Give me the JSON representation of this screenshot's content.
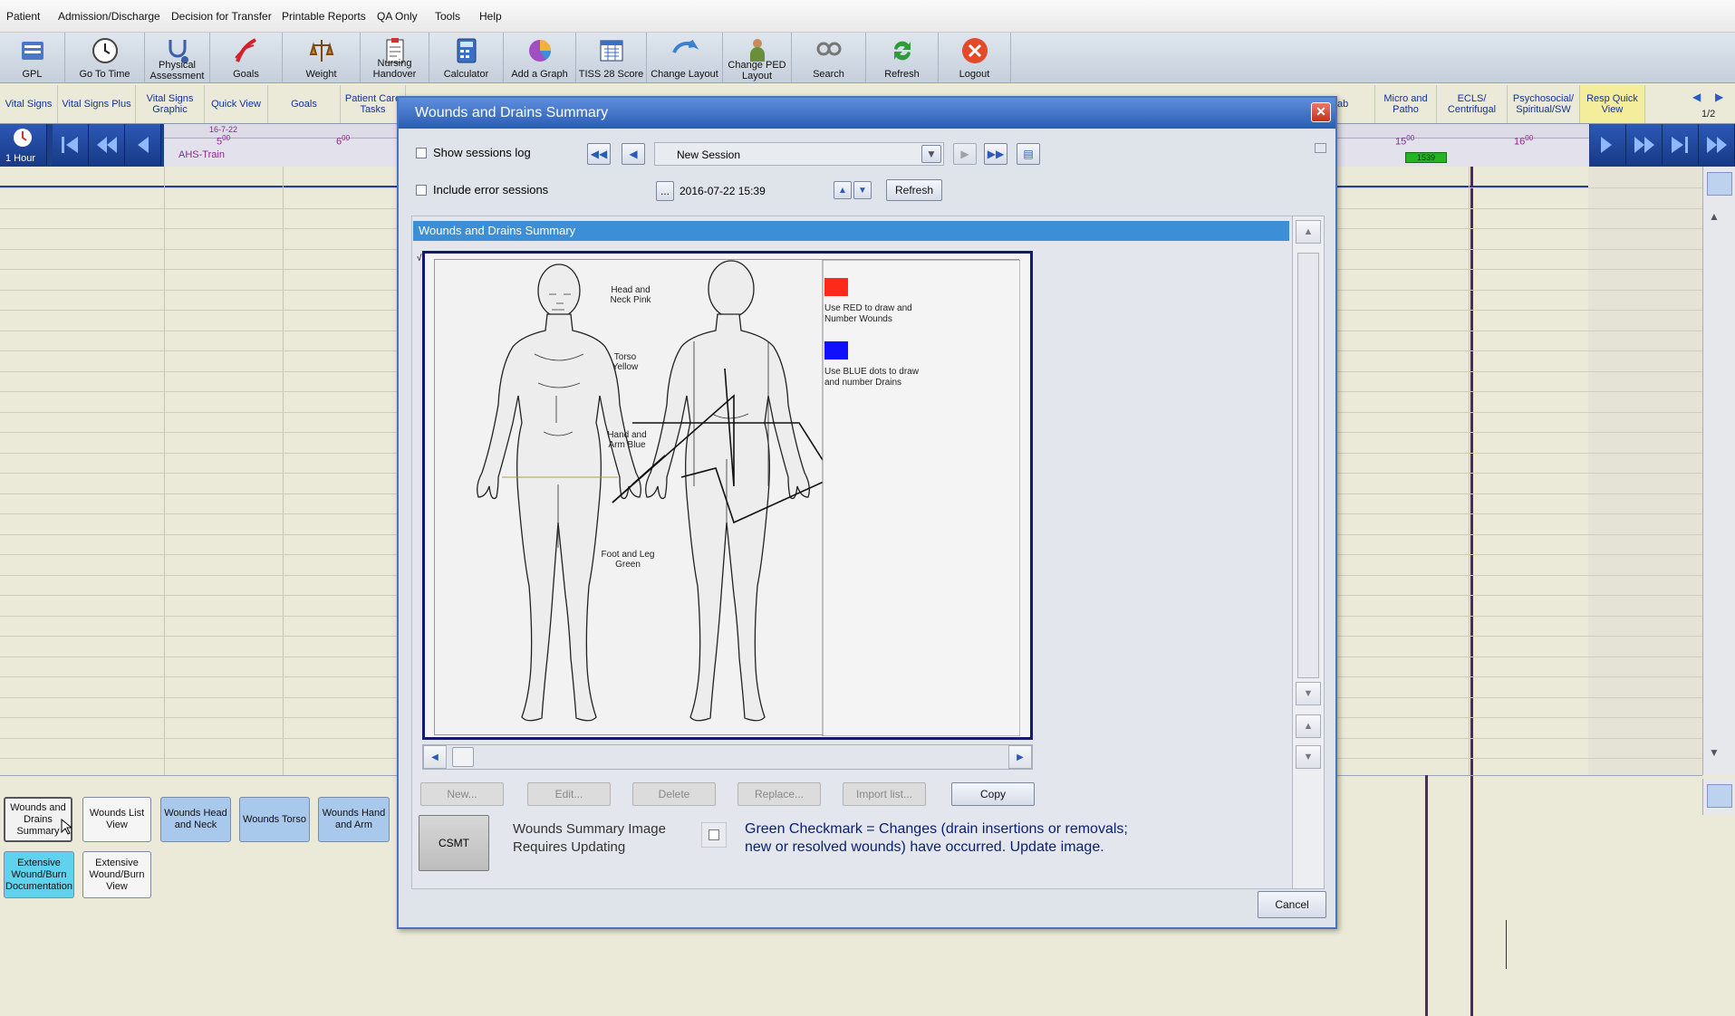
{
  "menu": [
    "Patient",
    "Admission/Discharge",
    "Decision for Transfer",
    "Printable Reports",
    "QA Only",
    "Tools",
    "Help"
  ],
  "toolbar": [
    {
      "label": "GPL",
      "icon": "gpl-icon"
    },
    {
      "label": "Go To Time",
      "icon": "clock-icon"
    },
    {
      "label": "Physical Assessment",
      "icon": "stethoscope-icon"
    },
    {
      "label": "Goals",
      "icon": "goals-icon"
    },
    {
      "label": "Weight",
      "icon": "scale-icon"
    },
    {
      "label": "Nursing Handover",
      "icon": "clipboard-icon"
    },
    {
      "label": "Calculator",
      "icon": "calculator-icon"
    },
    {
      "label": "Add a Graph",
      "icon": "graph-icon"
    },
    {
      "label": "TISS 28 Score",
      "icon": "tiss-icon"
    },
    {
      "label": "Change Layout",
      "icon": "layout-icon"
    },
    {
      "label": "Change PED Layout",
      "icon": "ped-layout-icon"
    },
    {
      "label": "Search",
      "icon": "search-icon"
    },
    {
      "label": "Refresh",
      "icon": "refresh-icon"
    },
    {
      "label": "Logout",
      "icon": "logout-icon"
    }
  ],
  "tabs_left": [
    "Vital Signs",
    "Vital Signs Plus",
    "Vital Signs Graphic",
    "Quick View",
    "Goals",
    "Patient Care Tasks"
  ],
  "tabs_right": [
    "ab",
    "Micro and Patho",
    "ECLS/ Centrifugal",
    "Psychosocial/ Spiritual/SW",
    "Resp Quick View"
  ],
  "page_indicator": "1/2",
  "timeline": {
    "interval": "1 Hour",
    "date": "16-7-22",
    "hours": [
      "5",
      "6",
      "15",
      "16"
    ],
    "unit_suffix": "00",
    "location": "AHS-Train",
    "current_time": "1539"
  },
  "left_buttons": [
    {
      "label": "Wounds and Drains Summary",
      "style": "white"
    },
    {
      "label": "Wounds List View",
      "style": "white"
    },
    {
      "label": "Wounds Head and Neck",
      "style": "blue"
    },
    {
      "label": "Wounds Torso",
      "style": "blue"
    },
    {
      "label": "Wounds Hand and Arm",
      "style": "blue"
    },
    {
      "label": "Extensive Wound/Burn Documentation",
      "style": "cyan"
    },
    {
      "label": "Extensive Wound/Burn View",
      "style": "white"
    }
  ],
  "dialog": {
    "title": "Wounds and Drains Summary",
    "show_sessions_log": "Show sessions log",
    "include_error_sessions": "Include error sessions",
    "session_select": "New Session",
    "datetime": "2016-07-22  15:39",
    "dots": "...",
    "refresh": "Refresh",
    "summary_header": "Wounds and Drains Summary",
    "check_mark": "√",
    "body_labels": {
      "head": "Head and Neck Pink",
      "torso": "Torso Yellow",
      "hand": "Hand and Arm Blue",
      "foot": "Foot and Leg Green"
    },
    "legend": [
      {
        "color": "#ff2a1a",
        "text": "Use RED to draw and Number Wounds"
      },
      {
        "color": "#1010ff",
        "text": "Use BLUE dots to draw and number Drains"
      }
    ],
    "buttons": {
      "new": "New...",
      "edit": "Edit...",
      "delete": "Delete",
      "replace": "Replace...",
      "import": "Import list...",
      "copy": "Copy"
    },
    "csmt": "CSMT",
    "update_label": "Wounds Summary Image Requires Updating",
    "note": "Green Checkmark  = Changes (drain insertions or removals; new or resolved wounds) have occurred. Update image.",
    "cancel": "Cancel"
  }
}
